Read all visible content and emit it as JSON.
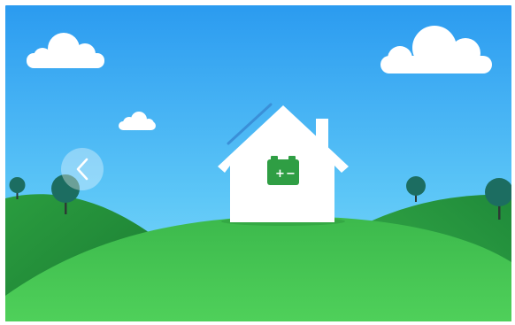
{
  "screen": {
    "background_top": "#2f9ff0",
    "background_bottom": "#7fdaf8",
    "hill_light": "#45c44f",
    "hill_dark": "#1f8a3a",
    "house_color": "#ffffff",
    "battery_color": "#2f9e44",
    "solar_line_color": "#3a8fd8"
  },
  "icons": {
    "back": "chevron-left-icon",
    "house": "house-icon",
    "battery": "battery-icon"
  },
  "battery": {
    "plus": "+",
    "minus": "−"
  }
}
